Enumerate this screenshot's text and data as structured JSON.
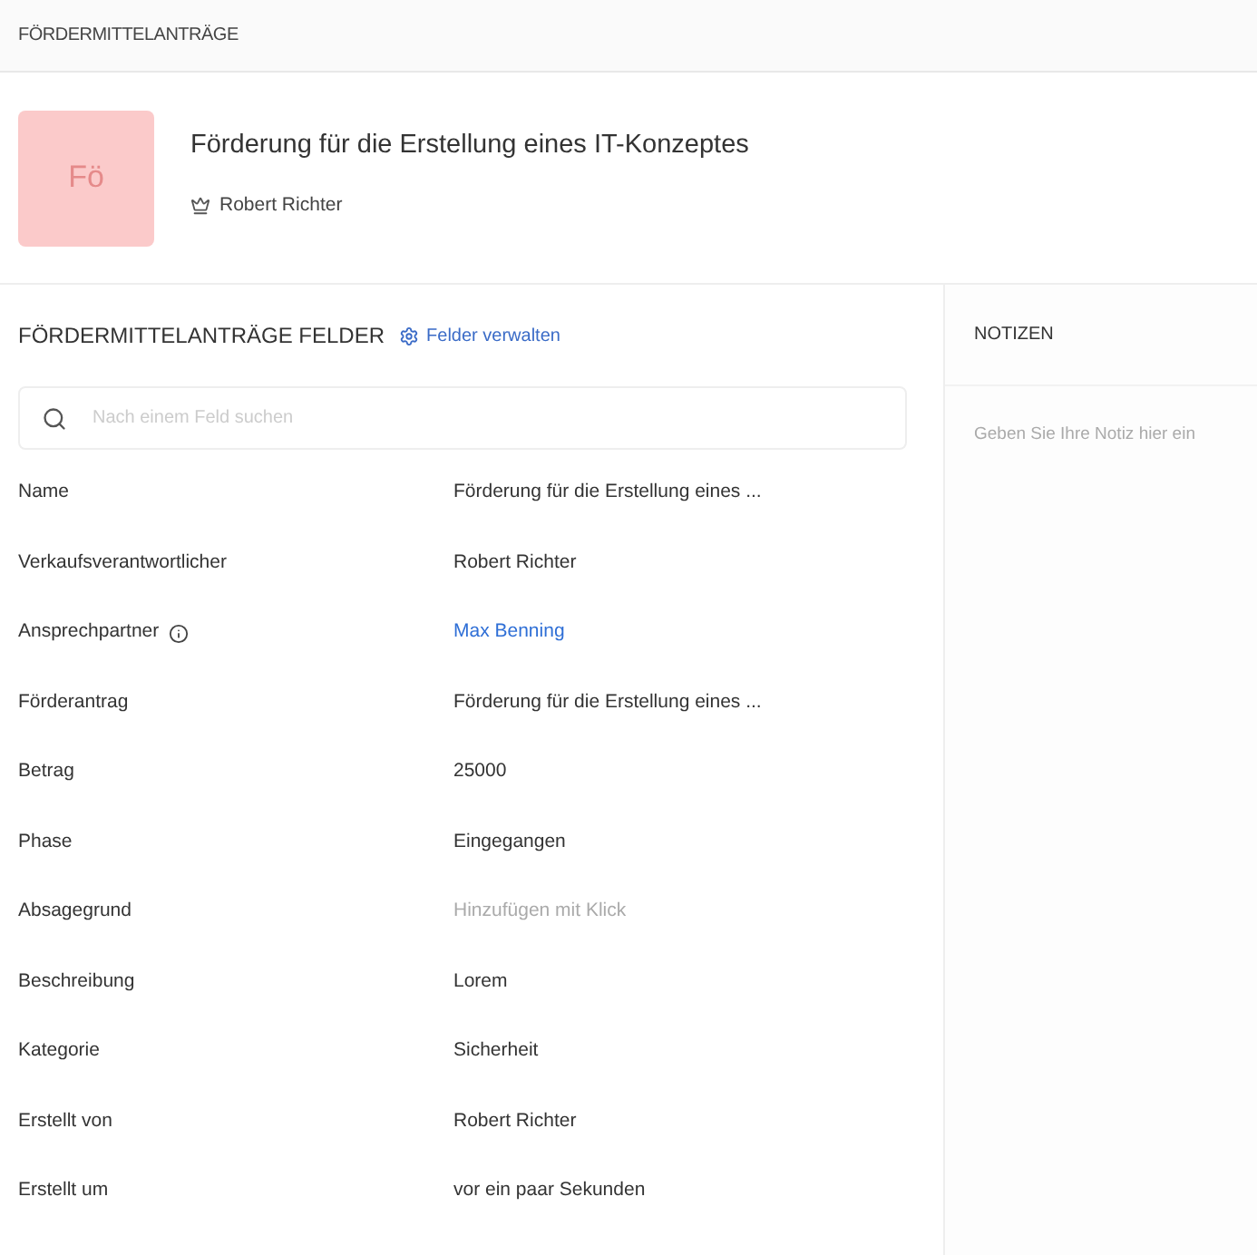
{
  "breadcrumb": "FÖRDERMITTELANTRÄGE",
  "record": {
    "avatar": "Fö",
    "title": "Förderung für die Erstellung eines IT-Konzeptes",
    "owner": "Robert Richter"
  },
  "fields_panel": {
    "title": "FÖRDERMITTELANTRÄGE FELDER",
    "manage_link": "Felder verwalten",
    "search": {
      "placeholder": "Nach einem Feld suchen"
    },
    "fields": [
      {
        "label": "Name",
        "value": "Förderung für die Erstellung eines ...",
        "kind": "text",
        "info": false
      },
      {
        "label": "Verkaufsverantwortlicher",
        "value": "Robert Richter",
        "kind": "text",
        "info": false
      },
      {
        "label": "Ansprechpartner",
        "value": "Max Benning",
        "kind": "link",
        "info": true
      },
      {
        "label": "Förderantrag",
        "value": "Förderung für die Erstellung eines ...",
        "kind": "text",
        "info": false
      },
      {
        "label": "Betrag",
        "value": "25000",
        "kind": "text",
        "info": false
      },
      {
        "label": "Phase",
        "value": "Eingegangen",
        "kind": "text",
        "info": false
      },
      {
        "label": "Absagegrund",
        "placeholder": "Hinzufügen mit Klick",
        "kind": "placeholder",
        "info": false
      },
      {
        "label": "Beschreibung",
        "value": "Lorem",
        "kind": "text",
        "info": false
      },
      {
        "label": "Kategorie",
        "value": "Sicherheit",
        "kind": "text",
        "info": false
      },
      {
        "label": "Erstellt von",
        "value": "Robert Richter",
        "kind": "text",
        "info": false
      },
      {
        "label": "Erstellt um",
        "value": "vor ein paar Sekunden",
        "kind": "text",
        "info": false
      }
    ]
  },
  "notes_panel": {
    "title": "NOTIZEN",
    "placeholder": "Geben Sie Ihre Notiz hier ein"
  }
}
